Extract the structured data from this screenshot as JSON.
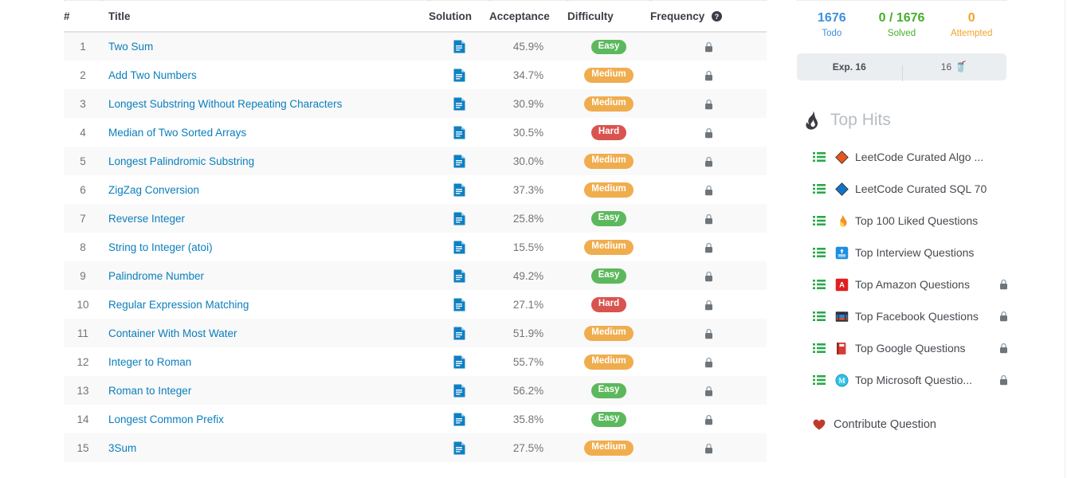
{
  "table": {
    "columns": {
      "num": "#",
      "title": "Title",
      "solution": "Solution",
      "acceptance": "Acceptance",
      "difficulty": "Difficulty",
      "frequency": "Frequency",
      "frequency_help_icon": "help-circle-icon"
    },
    "rows": [
      {
        "num": "1",
        "title": "Two Sum",
        "solution_icon": "solution-document-icon",
        "acceptance": "45.9%",
        "difficulty": "Easy",
        "locked_icon": "lock-icon"
      },
      {
        "num": "2",
        "title": "Add Two Numbers",
        "solution_icon": "solution-document-icon",
        "acceptance": "34.7%",
        "difficulty": "Medium",
        "locked_icon": "lock-icon"
      },
      {
        "num": "3",
        "title": "Longest Substring Without Repeating Characters",
        "solution_icon": "solution-document-icon",
        "acceptance": "30.9%",
        "difficulty": "Medium",
        "locked_icon": "lock-icon"
      },
      {
        "num": "4",
        "title": "Median of Two Sorted Arrays",
        "solution_icon": "solution-document-icon",
        "acceptance": "30.5%",
        "difficulty": "Hard",
        "locked_icon": "lock-icon"
      },
      {
        "num": "5",
        "title": "Longest Palindromic Substring",
        "solution_icon": "solution-document-icon",
        "acceptance": "30.0%",
        "difficulty": "Medium",
        "locked_icon": "lock-icon"
      },
      {
        "num": "6",
        "title": "ZigZag Conversion",
        "solution_icon": "solution-document-icon",
        "acceptance": "37.3%",
        "difficulty": "Medium",
        "locked_icon": "lock-icon"
      },
      {
        "num": "7",
        "title": "Reverse Integer",
        "solution_icon": "solution-document-icon",
        "acceptance": "25.8%",
        "difficulty": "Easy",
        "locked_icon": "lock-icon"
      },
      {
        "num": "8",
        "title": "String to Integer (atoi)",
        "solution_icon": "solution-document-icon",
        "acceptance": "15.5%",
        "difficulty": "Medium",
        "locked_icon": "lock-icon"
      },
      {
        "num": "9",
        "title": "Palindrome Number",
        "solution_icon": "solution-document-icon",
        "acceptance": "49.2%",
        "difficulty": "Easy",
        "locked_icon": "lock-icon"
      },
      {
        "num": "10",
        "title": "Regular Expression Matching",
        "solution_icon": "solution-document-icon",
        "acceptance": "27.1%",
        "difficulty": "Hard",
        "locked_icon": "lock-icon"
      },
      {
        "num": "11",
        "title": "Container With Most Water",
        "solution_icon": "solution-document-icon",
        "acceptance": "51.9%",
        "difficulty": "Medium",
        "locked_icon": "lock-icon"
      },
      {
        "num": "12",
        "title": "Integer to Roman",
        "solution_icon": "solution-document-icon",
        "acceptance": "55.7%",
        "difficulty": "Medium",
        "locked_icon": "lock-icon"
      },
      {
        "num": "13",
        "title": "Roman to Integer",
        "solution_icon": "solution-document-icon",
        "acceptance": "56.2%",
        "difficulty": "Easy",
        "locked_icon": "lock-icon"
      },
      {
        "num": "14",
        "title": "Longest Common Prefix",
        "solution_icon": "solution-document-icon",
        "acceptance": "35.8%",
        "difficulty": "Easy",
        "locked_icon": "lock-icon"
      },
      {
        "num": "15",
        "title": "3Sum",
        "solution_icon": "solution-document-icon",
        "acceptance": "27.5%",
        "difficulty": "Medium",
        "locked_icon": "lock-icon"
      }
    ]
  },
  "sidebar": {
    "stats": [
      {
        "value": "1676",
        "label": "Todo"
      },
      {
        "value": "0 / 1676",
        "label": "Solved"
      },
      {
        "value": "0",
        "label": "Attempted"
      }
    ],
    "exp_box": {
      "left": "Exp. 16",
      "right_value": "16",
      "right_icon": "cookie-icon"
    },
    "top_hits": {
      "icon": "fire-icon",
      "title": "Top Hits",
      "items": [
        {
          "list_icon": "list-icon",
          "tag_icon": "orange-diamond-icon",
          "label": "LeetCode Curated Algo ...",
          "locked": false
        },
        {
          "list_icon": "list-icon",
          "tag_icon": "blue-diamond-icon",
          "label": "LeetCode Curated SQL 70",
          "locked": false
        },
        {
          "list_icon": "list-icon",
          "tag_icon": "flame-icon",
          "label": "Top 100 Liked Questions",
          "locked": false
        },
        {
          "list_icon": "list-icon",
          "tag_icon": "interview-badge-icon",
          "label": "Top Interview Questions",
          "locked": false
        },
        {
          "list_icon": "list-icon",
          "tag_icon": "amazon-icon",
          "label": "Top Amazon Questions",
          "locked": true
        },
        {
          "list_icon": "list-icon",
          "tag_icon": "facebook-icon",
          "label": "Top Facebook Questions",
          "locked": true
        },
        {
          "list_icon": "list-icon",
          "tag_icon": "google-icon",
          "label": "Top Google Questions",
          "locked": true
        },
        {
          "list_icon": "list-icon",
          "tag_icon": "microsoft-icon",
          "label": "Top Microsoft Questio...",
          "locked": true
        }
      ]
    },
    "contribute": {
      "icon": "heart-icon",
      "label": "Contribute Question"
    }
  },
  "colors": {
    "easy": "#5cb85c",
    "medium": "#f0ad4e",
    "hard": "#d9534f",
    "link": "#0a7ebd",
    "todo": "#3e8fdd",
    "solved": "#43b02a",
    "attempted": "#f0a328"
  }
}
